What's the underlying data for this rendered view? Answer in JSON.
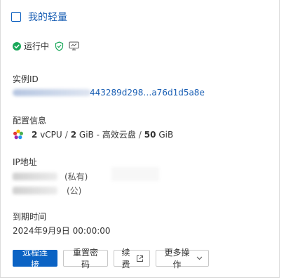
{
  "instance": {
    "name": "我的轻量",
    "status": "运行中",
    "status_color": "#1aa85a"
  },
  "id_section": {
    "label": "实例ID",
    "value_visible": "443289d298…a76d1d5a8e"
  },
  "config_section": {
    "label": "配置信息",
    "cpu_count": "2",
    "cpu_unit": "vCPU",
    "mem_count": "2",
    "mem_unit": "GiB - 高效云盘",
    "disk_count": "50",
    "disk_unit": "GiB",
    "separator": "/"
  },
  "ip_section": {
    "label": "IP地址",
    "private_tag": "(私有)",
    "public_tag": "(公)"
  },
  "expire_section": {
    "label": "到期时间",
    "value": "2024年9月9日 00:00:00"
  },
  "actions": {
    "remote_connect": "远程连接",
    "reset_password": "重置密码",
    "renew": "续费",
    "more": "更多操作"
  },
  "colors": {
    "primary": "#0b63c4",
    "link": "#1a5fb4"
  },
  "icons": {
    "status": "check-circle-icon",
    "shield": "shield-check-icon",
    "monitor": "monitor-icon",
    "config": "gear-flower-icon",
    "renew_trail": "external-link-icon",
    "more_trail": "chevron-down-icon"
  }
}
